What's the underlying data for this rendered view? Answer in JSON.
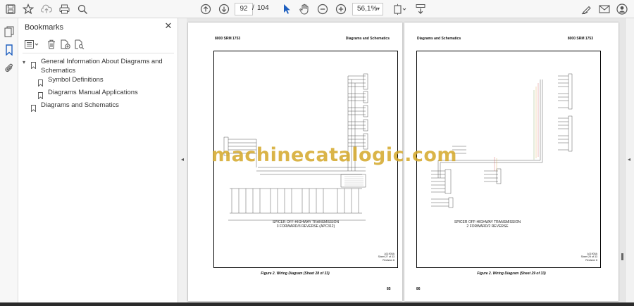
{
  "toolbar": {
    "current_page": "92",
    "page_separator": "/",
    "total_pages": "104",
    "zoom": "56,1%"
  },
  "bookmarks_panel": {
    "title": "Bookmarks",
    "items": [
      {
        "label": "General Information About Diagrams and Schematics",
        "expanded": true
      },
      {
        "label": "Symbol Definitions"
      },
      {
        "label": "Diagrams Manual Applications"
      },
      {
        "label": "Diagrams and Schematics"
      }
    ]
  },
  "pages": {
    "left": {
      "header_left": "8000 SRM 1753",
      "header_right": "Diagrams and Schematics",
      "figure_title_line1": "SPICER OFF-HIGHWAY TRANSMISSION",
      "figure_title_line2": "3 FORWARD/3 REVERSE (APC312)",
      "ref_line1": "A11905A",
      "ref_line2": "Sheet 27 of 33",
      "ref_line3": "Revision 6",
      "caption": "Figure 2. Wiring Diagram (Sheet 28 of 33)",
      "page_number": "85"
    },
    "right": {
      "header_left": "Diagrams and Schematics",
      "header_right": "8000 SRM 1753",
      "figure_title_line1": "SPICER OFF-HIGHWAY TRANSMISSION",
      "figure_title_line2": "2 FORWARD/2 REVERSE",
      "ref_line1": "A11905A",
      "ref_line2": "Sheet 29 of 33",
      "ref_line3": "Revision 6",
      "caption": "Figure 2. Wiring Diagram (Sheet 29 of 33)",
      "page_number": "86"
    }
  },
  "watermark": "machinecatalogic.com",
  "colors": {
    "accent": "#1e5fbf",
    "watermark": "#d4a829"
  }
}
